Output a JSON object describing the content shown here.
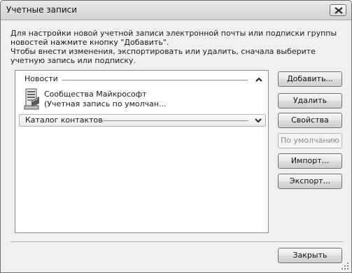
{
  "window": {
    "title": "Учетные записи"
  },
  "description": {
    "line1": "Для настройки новой учетной записи электронной почты или подписки группы новостей нажмите кнопку \"Добавить\".",
    "line2": "Чтобы внести изменения, экспортировать или удалить, сначала выберите учетную запись или подписку."
  },
  "accounts_list": {
    "groups": [
      {
        "label": "Новости",
        "state": "expanded",
        "items": [
          {
            "name": "Сообщества Майкрософт",
            "subtitle": "(Учетная запись по умолчан..."
          }
        ]
      },
      {
        "label": "Каталог контактов",
        "state": "collapsed",
        "items": []
      }
    ]
  },
  "buttons": {
    "add": "Добавить...",
    "remove": "Удалить",
    "properties": "Свойства",
    "default": "По умолчанию",
    "import": "Импорт...",
    "export": "Экспорт...",
    "close": "Закрыть"
  },
  "icons": {
    "window_close": "close-icon",
    "expand": "chevron-up-icon",
    "collapse": "chevron-down-icon",
    "account": "news-server-icon"
  }
}
